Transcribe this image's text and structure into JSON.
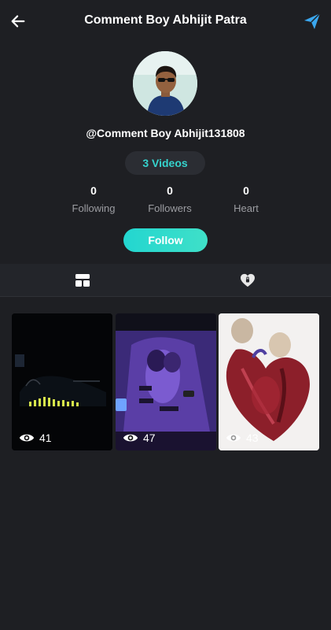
{
  "header": {
    "title": "Comment Boy Abhijit Patra",
    "back_icon": "arrow-left-icon",
    "send_icon": "paper-plane-icon"
  },
  "profile": {
    "username": "@Comment Boy Abhijit131808",
    "videos_count_label": "3 Videos",
    "stats": [
      {
        "value": "0",
        "label": "Following"
      },
      {
        "value": "0",
        "label": "Followers"
      },
      {
        "value": "0",
        "label": "Heart"
      }
    ],
    "follow_label": "Follow"
  },
  "tabs": [
    {
      "icon": "grid-layout-icon"
    },
    {
      "icon": "heart-lock-icon"
    }
  ],
  "videos": [
    {
      "views": "41"
    },
    {
      "views": "47"
    },
    {
      "views": "43"
    }
  ],
  "colors": {
    "background": "#1e1f23",
    "accent": "#35d3cd",
    "follow_button": "#23d6d0"
  }
}
